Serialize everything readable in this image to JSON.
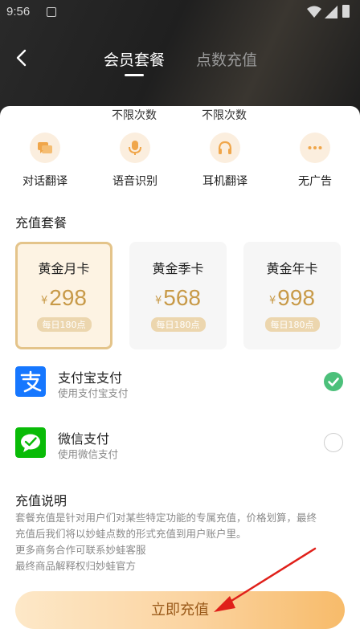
{
  "status_bar": {
    "time": "9:56"
  },
  "header": {
    "tabs": [
      {
        "label": "会员套餐",
        "active": true
      },
      {
        "label": "点数充值",
        "active": false
      }
    ]
  },
  "features": [
    {
      "label": "对话翻译",
      "note": "",
      "icon": "chat-icon"
    },
    {
      "label": "语音识别",
      "note": "不限次数",
      "icon": "microphone-icon"
    },
    {
      "label": "耳机翻译",
      "note": "不限次数",
      "icon": "headphones-icon"
    },
    {
      "label": "无广告",
      "note": "",
      "icon": "more-dots-icon"
    }
  ],
  "plans_section": {
    "title": "充值套餐",
    "plans": [
      {
        "name": "黄金月卡",
        "currency": "¥",
        "price": "298",
        "badge": "每日180点",
        "selected": true
      },
      {
        "name": "黄金季卡",
        "currency": "¥",
        "price": "568",
        "badge": "每日180点",
        "selected": false
      },
      {
        "name": "黄金年卡",
        "currency": "¥",
        "price": "998",
        "badge": "每日180点",
        "selected": false
      }
    ]
  },
  "payment_methods": [
    {
      "title": "支付宝支付",
      "subtitle": "使用支付宝支付",
      "selected": true,
      "icon": "alipay-icon",
      "color": "#1677ff"
    },
    {
      "title": "微信支付",
      "subtitle": "使用微信支付",
      "selected": false,
      "icon": "wechat-icon",
      "color": "#09bb07"
    }
  ],
  "recharge_info": {
    "title": "充值说明",
    "lines": [
      "套餐充值是针对用户们对某些特定功能的专属充值，价格划算，最终",
      "充值后我们将以妙蛙点数的形式充值到用户账户里。",
      "更多商务合作可联系妙蛙客服",
      "最终商品解释权归妙蛙官方"
    ]
  },
  "cta": {
    "label": "立即充值"
  },
  "colors": {
    "accent_gold": "#c89a48",
    "cta_text": "#9a5a1a",
    "check_green": "#4cc07a",
    "arrow_red": "#e0201a"
  }
}
